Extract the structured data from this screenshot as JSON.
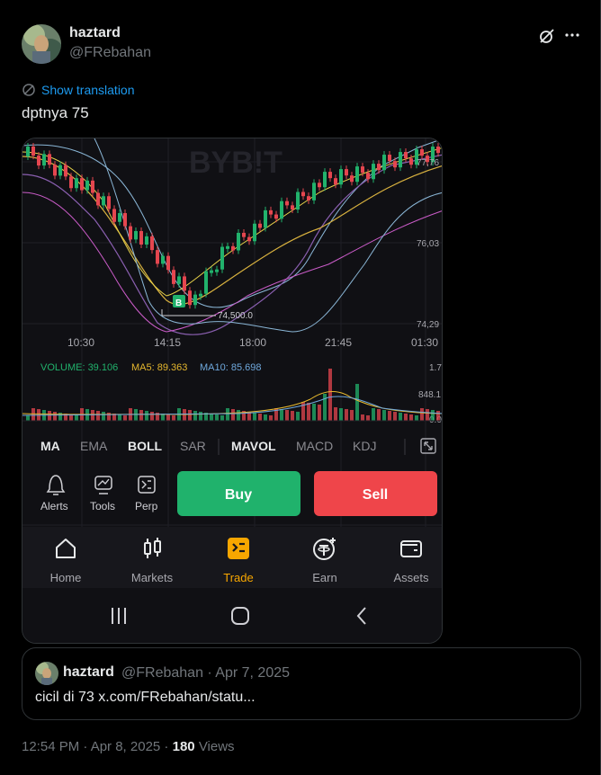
{
  "post": {
    "display_name": "haztard",
    "handle": "@FRebahan",
    "show_translation": "Show translation",
    "text": "dptnya 75",
    "time": "12:54 PM · Apr 8, 2025 ·",
    "views_count": "180",
    "views_label": "Views"
  },
  "quote": {
    "display_name": "haztard",
    "meta": "@FRebahan · Apr 7, 2025",
    "text": "cicil di 73 x.com/FRebahan/statu..."
  },
  "app": {
    "watermark": "BYB!T",
    "price_labels": [
      "77,76",
      "76,03",
      "74,29"
    ],
    "low_marker": "74,500.0",
    "buy_marker": "B",
    "time_labels": [
      "10:30",
      "14:15",
      "18:00",
      "21:45",
      "01:30"
    ],
    "volume_info": {
      "volume": "VOLUME: 39.106",
      "ma5": "MA5: 89.363",
      "ma10": "MA10: 85.698"
    },
    "volume_axis": [
      "1.7",
      "848.1",
      "0.0"
    ],
    "indicators": [
      "MA",
      "EMA",
      "BOLL",
      "SAR",
      "MAVOL",
      "MACD",
      "KDJ"
    ],
    "tools": [
      {
        "label": "Alerts",
        "icon": "bell-icon"
      },
      {
        "label": "Tools",
        "icon": "chart-tools-icon"
      },
      {
        "label": "Perp",
        "icon": "perp-icon"
      }
    ],
    "buy_label": "Buy",
    "sell_label": "Sell",
    "nav": [
      {
        "label": "Home",
        "icon": "home-icon"
      },
      {
        "label": "Markets",
        "icon": "candlestick-icon"
      },
      {
        "label": "Trade",
        "icon": "trade-icon"
      },
      {
        "label": "Earn",
        "icon": "tether-icon"
      },
      {
        "label": "Assets",
        "icon": "wallet-icon"
      }
    ],
    "colors": {
      "up": "#21b26c",
      "down": "#e5464f",
      "accent": "#f7a600",
      "buy": "#20b26c",
      "sell": "#ef454a",
      "link": "#1d9bf0"
    }
  }
}
